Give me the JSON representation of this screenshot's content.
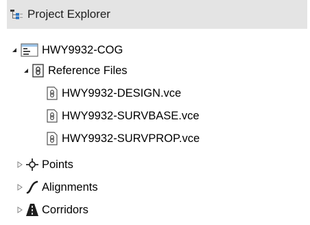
{
  "header": {
    "title": "Project Explorer",
    "icon": "tree-view-icon"
  },
  "tree": {
    "root": {
      "label": "HWY9932-COG",
      "icon": "project-icon",
      "expanded": true,
      "children": {
        "reference_files": {
          "label": "Reference Files",
          "icon": "reference-files-icon",
          "expanded": true,
          "files": [
            {
              "label": "HWY9932-DESIGN.vce",
              "icon": "reference-file-icon"
            },
            {
              "label": "HWY9932-SURVBASE.vce",
              "icon": "reference-file-icon"
            },
            {
              "label": "HWY9932-SURVPROP.vce",
              "icon": "reference-file-icon"
            }
          ]
        },
        "points": {
          "label": "Points",
          "icon": "points-icon",
          "expanded": false
        },
        "alignments": {
          "label": "Alignments",
          "icon": "alignment-icon",
          "expanded": false
        },
        "corridors": {
          "label": "Corridors",
          "icon": "corridor-icon",
          "expanded": false
        }
      }
    }
  },
  "colors": {
    "header_bg": "#e4e4e4",
    "text": "#000000",
    "icon_gray": "#555555"
  }
}
